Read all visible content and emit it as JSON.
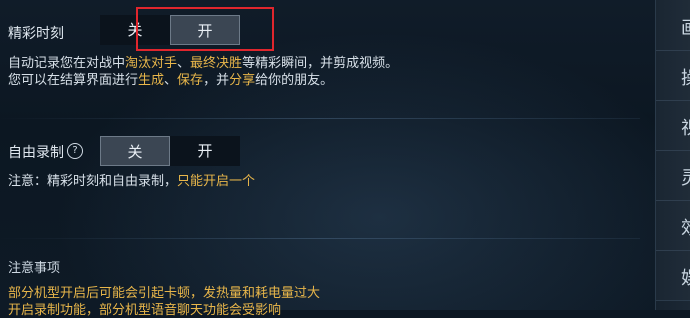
{
  "highlights": {
    "title": "精彩时刻",
    "toggle_off": "关",
    "toggle_on": "开",
    "desc_line1": [
      "自动记录您在对战中",
      "淘汰对手",
      "、",
      "最终决胜",
      "等精彩瞬间，并剪成视频。"
    ],
    "desc_line2": [
      "您可以在结算界面进行",
      "生成",
      "、",
      "保存",
      "，并",
      "分享",
      "给你的朋友。"
    ]
  },
  "free_record": {
    "title": "自由录制",
    "toggle_off": "关",
    "toggle_on": "开",
    "note_prefix": "注意：精彩时刻和自由录制，",
    "note_highlight": "只能开启一个"
  },
  "notes": {
    "title": "注意事项",
    "line1": "部分机型开启后可能会引起卡顿，发热量和耗电量过大",
    "line2": "开启录制功能，部分机型语音聊天功能会受影响"
  },
  "sidebar": {
    "items": [
      "画",
      "操",
      "视",
      "灵",
      "效",
      "娱"
    ]
  },
  "colors": {
    "highlight": "#e8b64a",
    "red_annotation": "#e0262d"
  }
}
